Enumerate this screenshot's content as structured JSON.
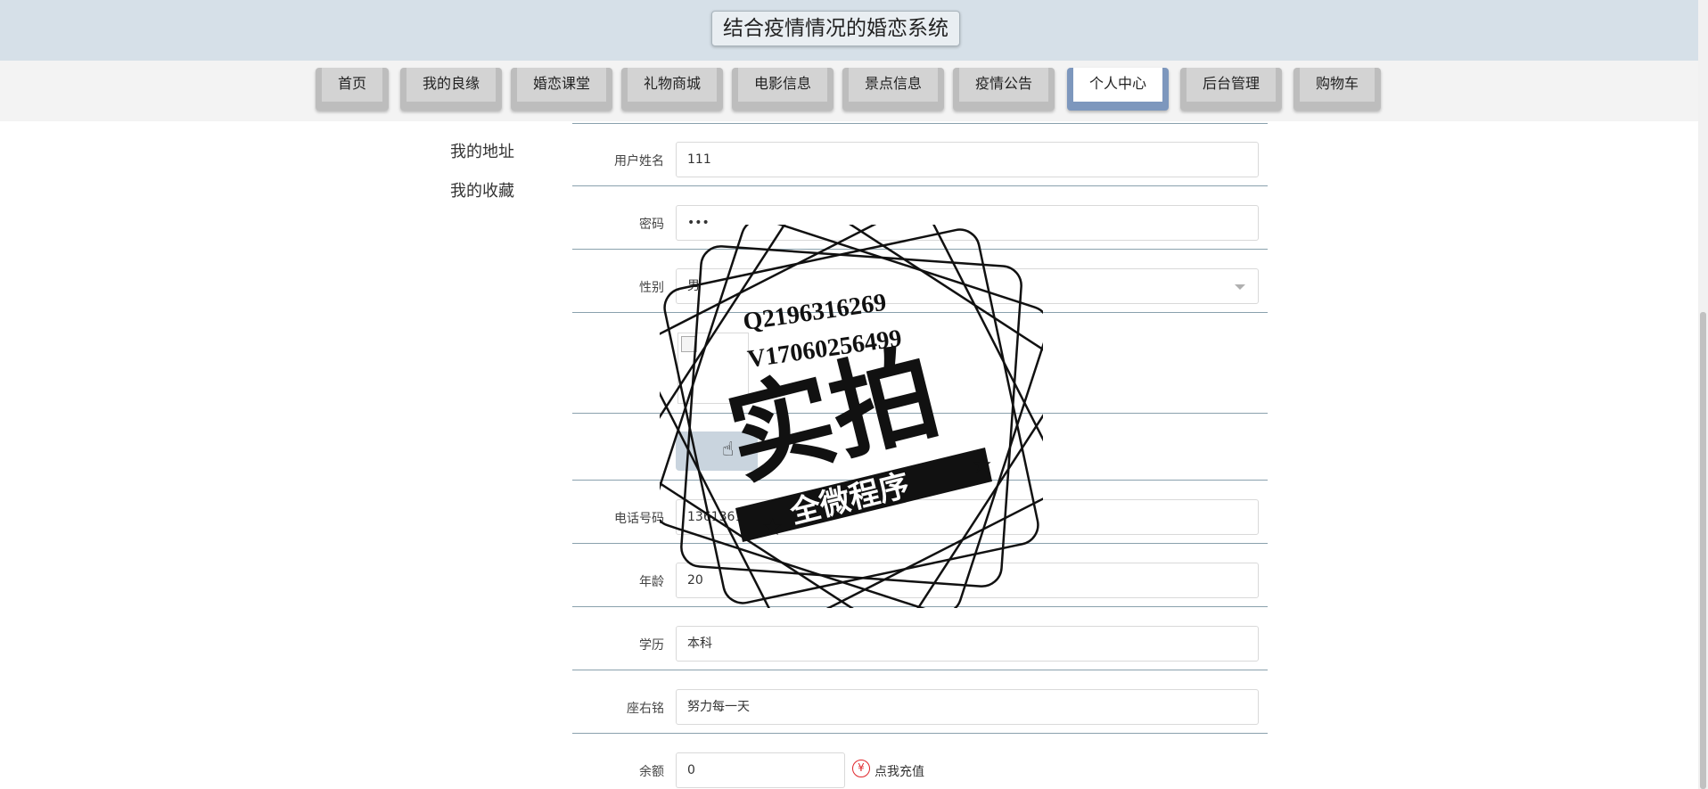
{
  "header": {
    "title": "结合疫情情况的婚恋系统"
  },
  "nav": {
    "items": [
      {
        "label": "首页"
      },
      {
        "label": "我的良缘"
      },
      {
        "label": "婚恋课堂"
      },
      {
        "label": "礼物商城"
      },
      {
        "label": "电影信息"
      },
      {
        "label": "景点信息"
      },
      {
        "label": "疫情公告"
      },
      {
        "label": "个人中心",
        "active": true
      },
      {
        "label": "后台管理"
      },
      {
        "label": "购物车"
      }
    ]
  },
  "sidebar": {
    "links": [
      {
        "label": "我的地址"
      },
      {
        "label": "我的收藏"
      }
    ]
  },
  "form": {
    "username": {
      "label": "用户姓名",
      "value": "111"
    },
    "password": {
      "label": "密码",
      "value": "•••"
    },
    "gender": {
      "label": "性别",
      "value": "男"
    },
    "phone": {
      "label": "电话号码",
      "value": "13613613666"
    },
    "age": {
      "label": "年龄",
      "value": "20"
    },
    "education": {
      "label": "学历",
      "value": "本科"
    },
    "motto": {
      "label": "座右铭",
      "value": "努力每一天"
    },
    "balance": {
      "label": "余额",
      "value": "0",
      "recharge_icon": "¥",
      "recharge_label": "点我充值"
    }
  },
  "watermark": {
    "contact_q": "Q2196316269",
    "contact_v": "V17060256499",
    "main": "实拍",
    "ribbon": "全微程序"
  },
  "colors": {
    "header_bg": "#d6e0e8",
    "nav_active": "#7d97bd",
    "accent_red": "#e0262b"
  }
}
